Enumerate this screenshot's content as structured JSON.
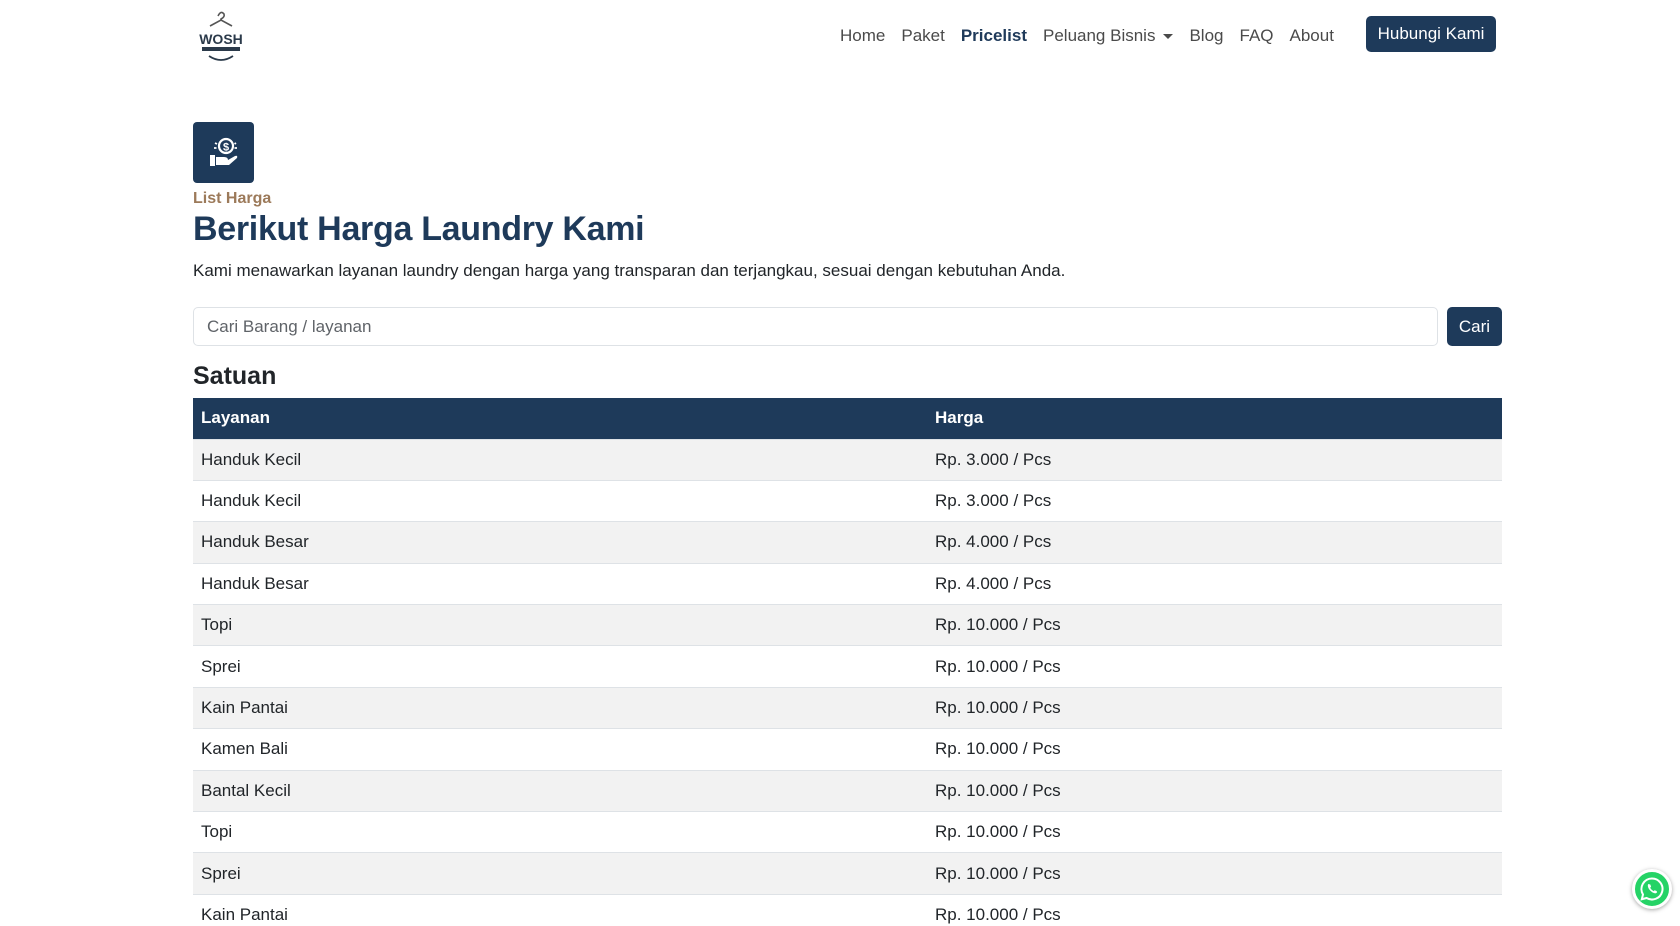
{
  "nav": {
    "links": [
      {
        "label": "Home",
        "active": false
      },
      {
        "label": "Paket",
        "active": false
      },
      {
        "label": "Pricelist",
        "active": true
      },
      {
        "label": "Peluang Bisnis",
        "active": false,
        "dropdown": true
      },
      {
        "label": "Blog",
        "active": false
      },
      {
        "label": "FAQ",
        "active": false
      },
      {
        "label": "About",
        "active": false
      }
    ],
    "cta_label": "Hubungi Kami"
  },
  "hero": {
    "icon": "money-hand-icon",
    "eyebrow": "List Harga",
    "title": "Berikut Harga Laundry Kami",
    "description": "Kami menawarkan layanan laundry dengan harga yang transparan dan terjangkau, sesuai dengan kebutuhan Anda."
  },
  "search": {
    "placeholder": "Cari Barang / layanan",
    "value": "",
    "button_label": "Cari"
  },
  "section": {
    "title": "Satuan",
    "columns": [
      "Layanan",
      "Harga"
    ],
    "rows": [
      {
        "service": "Handuk Kecil",
        "price": "Rp. 3.000 / Pcs"
      },
      {
        "service": "Handuk Kecil",
        "price": "Rp. 3.000 / Pcs"
      },
      {
        "service": "Handuk Besar",
        "price": "Rp. 4.000 / Pcs"
      },
      {
        "service": "Handuk Besar",
        "price": "Rp. 4.000 / Pcs"
      },
      {
        "service": "Topi",
        "price": "Rp. 10.000 / Pcs"
      },
      {
        "service": "Sprei",
        "price": "Rp. 10.000 / Pcs"
      },
      {
        "service": "Kain Pantai",
        "price": "Rp. 10.000 / Pcs"
      },
      {
        "service": "Kamen Bali",
        "price": "Rp. 10.000 / Pcs"
      },
      {
        "service": "Bantal Kecil",
        "price": "Rp. 10.000 / Pcs"
      },
      {
        "service": "Topi",
        "price": "Rp. 10.000 / Pcs"
      },
      {
        "service": "Sprei",
        "price": "Rp. 10.000 / Pcs"
      },
      {
        "service": "Kain Pantai",
        "price": "Rp. 10.000 / Pcs"
      }
    ]
  },
  "colors": {
    "primary": "#1e3a5a",
    "accent": "#9c7a5a",
    "whatsapp": "#25d366",
    "stripe": "#f2f2f2"
  }
}
